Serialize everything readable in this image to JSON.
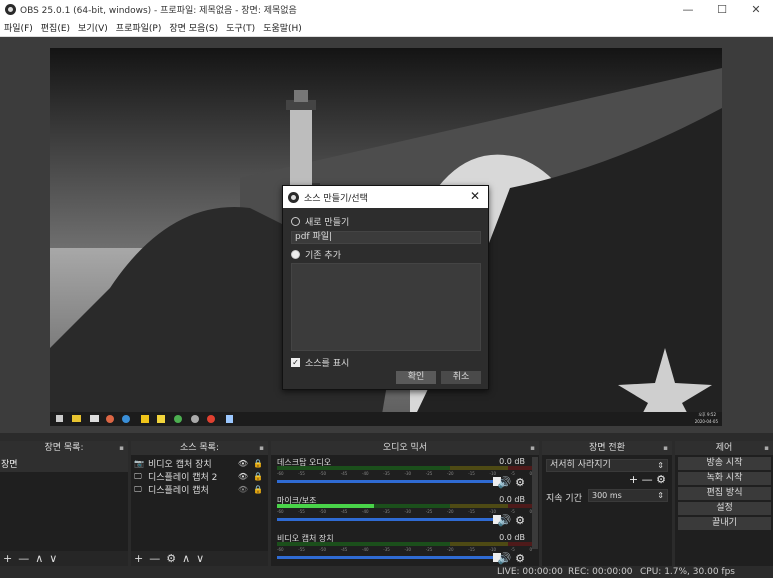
{
  "window": {
    "title": "OBS 25.0.1 (64-bit, windows) - 프로파일: 제목없음 - 장면: 제목없음",
    "minimize": "—",
    "maximize": "☐",
    "close": "✕"
  },
  "menu": [
    "파일(F)",
    "편집(E)",
    "보기(V)",
    "프로파일(P)",
    "장면 모음(S)",
    "도구(T)",
    "도움말(H)"
  ],
  "preview": {
    "clock_time": "오후 9:52",
    "clock_date": "2020-04-05"
  },
  "dialog": {
    "title": "소스 만들기/선택",
    "close": "✕",
    "option_new": "새로 만들기",
    "input_value": "pdf 파일|",
    "option_existing": "기존 추가",
    "checkbox_label": "소스를 표시",
    "ok": "확인",
    "cancel": "취소"
  },
  "scenes": {
    "header": "장면 목록:",
    "items": [
      "장면"
    ],
    "footer": [
      "+",
      "—",
      "∧",
      "∨"
    ]
  },
  "sources": {
    "header": "소스 목록:",
    "items": [
      {
        "label": "비디오 캡처 장치",
        "icon": "camera-icon"
      },
      {
        "label": "디스플레이 캡처 2",
        "icon": "monitor-icon"
      },
      {
        "label": "디스플레이 캡처",
        "icon": "monitor-icon"
      }
    ],
    "footer": [
      "+",
      "—",
      "⚙",
      "∧",
      "∨"
    ]
  },
  "mixer": {
    "header": "오디오 믹서",
    "channels": [
      {
        "name": "데스크탑 오디오",
        "db": "0.0 dB",
        "level": 0.0
      },
      {
        "name": "마이크/보조",
        "db": "0.0 dB",
        "level": 0.38
      },
      {
        "name": "비디오 캡처 장치",
        "db": "0.0 dB",
        "level": 0.0
      }
    ],
    "ticks": [
      "-60",
      "-55",
      "-50",
      "-45",
      "-40",
      "-35",
      "-30",
      "-25",
      "-20",
      "-15",
      "-10",
      "-5",
      "0"
    ]
  },
  "transitions": {
    "header": "장면 전환",
    "selected": "서서히 사라지기",
    "duration_label": "지속 기간",
    "duration_value": "300 ms"
  },
  "controls": {
    "header": "제어",
    "buttons": [
      "방송 시작",
      "녹화 시작",
      "편집 방식",
      "설정",
      "끝내기"
    ]
  },
  "status": {
    "live": "LIVE: 00:00:00",
    "rec": "REC: 00:00:00",
    "cpu": "CPU: 1.7%, 30.00 fps"
  },
  "colors": {
    "accent_blue": "#2f6bd3",
    "meter_green": "#49d349",
    "panel_bg": "#1f1f1f"
  }
}
